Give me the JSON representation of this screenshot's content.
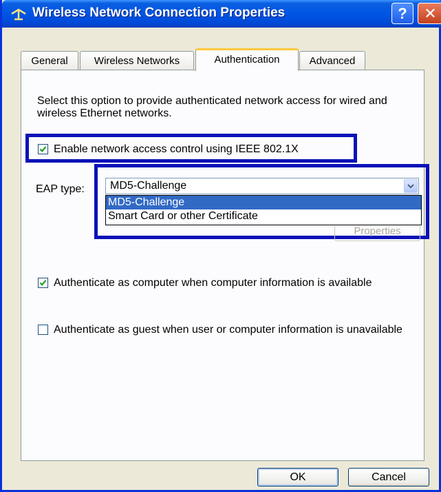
{
  "window": {
    "title": "Wireless Network Connection Properties",
    "help_label": "?",
    "close_label": "✕",
    "title_icon": "network-connection-icon"
  },
  "tabs": [
    {
      "label": "General",
      "active": false
    },
    {
      "label": "Wireless Networks",
      "active": false
    },
    {
      "label": "Authentication",
      "active": true
    },
    {
      "label": "Advanced",
      "active": false
    }
  ],
  "authentication": {
    "description": "Select this option to provide authenticated network access for wired and wireless Ethernet networks.",
    "enable_8021x": {
      "label": "Enable network access control using IEEE 802.1X",
      "checked": true
    },
    "eap_type_label": "EAP type:",
    "eap_selected": "MD5-Challenge",
    "eap_options": [
      "MD5-Challenge",
      "Smart Card or other Certificate"
    ],
    "properties_label": "Properties",
    "auth_as_computer": {
      "label": "Authenticate as computer when computer information is available",
      "checked": true
    },
    "auth_as_guest": {
      "label": "Authenticate as guest when user or computer information is unavailable",
      "checked": false
    }
  },
  "buttons": {
    "ok": "OK",
    "cancel": "Cancel"
  },
  "colors": {
    "highlight_box": "#0A11B8",
    "selection": "#316AC5",
    "titlebar": "#0055E5"
  }
}
